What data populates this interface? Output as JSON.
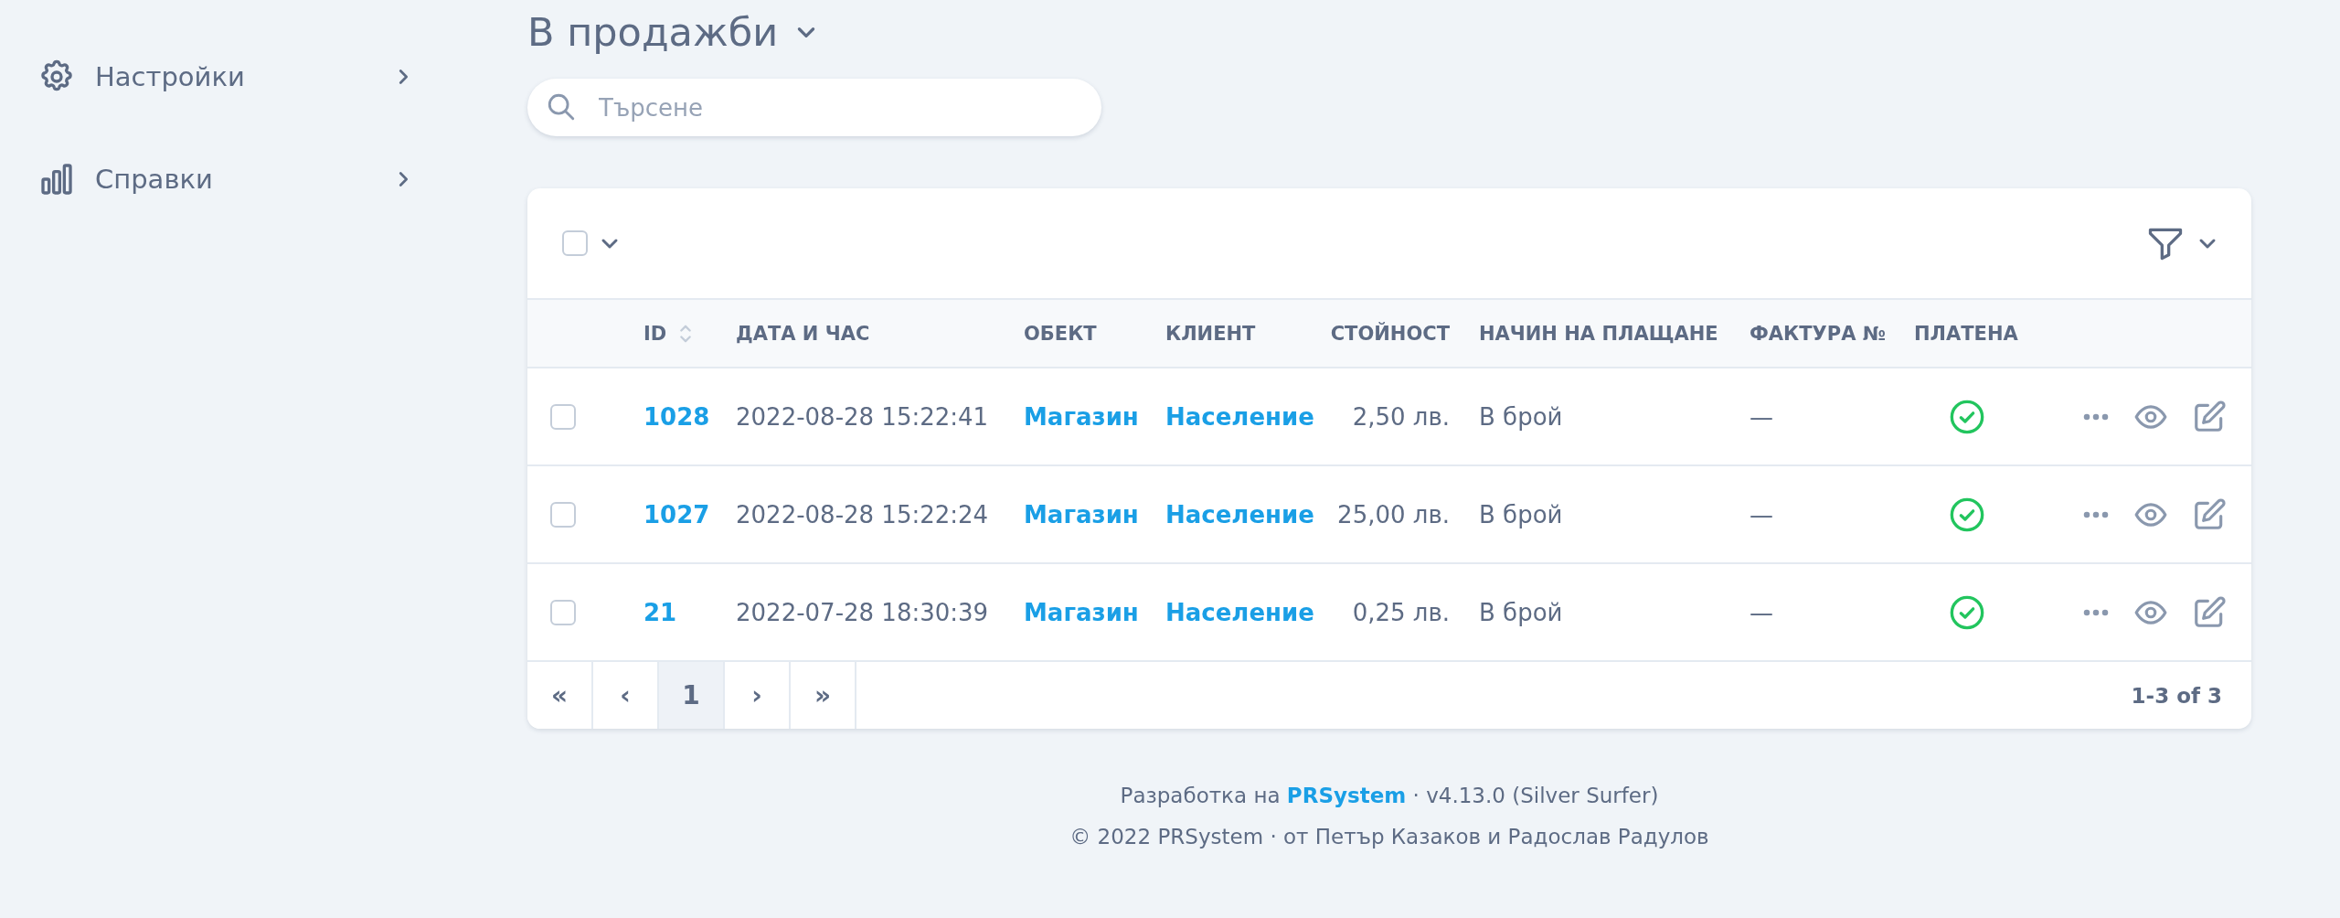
{
  "sidebar": {
    "items": [
      {
        "label": "Настройки"
      },
      {
        "label": "Справки"
      }
    ]
  },
  "page": {
    "title": "В продажби"
  },
  "search": {
    "placeholder": "Търсене"
  },
  "table": {
    "select_all": {
      "checked": false
    },
    "columns": [
      {
        "label": "ID"
      },
      {
        "label": "ДАТА И ЧАС"
      },
      {
        "label": "ОБЕКТ"
      },
      {
        "label": "КЛИЕНТ"
      },
      {
        "label": "СТОЙНОСТ"
      },
      {
        "label": "НАЧИН НА ПЛАЩАНЕ"
      },
      {
        "label": "ФАКТУРА №"
      },
      {
        "label": "ПЛАТЕНА"
      }
    ],
    "rows": [
      {
        "checked": false,
        "id": "1028",
        "datetime": "2022-08-28 15:22:41",
        "object": "Магазин",
        "client": "Население",
        "value": "2,50 лв.",
        "payment": "В брой",
        "invoice": "—",
        "paid": true
      },
      {
        "checked": false,
        "id": "1027",
        "datetime": "2022-08-28 15:22:24",
        "object": "Магазин",
        "client": "Население",
        "value": "25,00 лв.",
        "payment": "В брой",
        "invoice": "—",
        "paid": true
      },
      {
        "checked": false,
        "id": "21",
        "datetime": "2022-07-28 18:30:39",
        "object": "Магазин",
        "client": "Население",
        "value": "0,25 лв.",
        "payment": "В брой",
        "invoice": "—",
        "paid": true
      }
    ],
    "pagination": {
      "pages": [
        {
          "label": "«",
          "selected": false
        },
        {
          "label": "‹",
          "selected": false
        },
        {
          "label": "1",
          "selected": true
        },
        {
          "label": "›",
          "selected": false
        },
        {
          "label": "»",
          "selected": false
        }
      ],
      "summary": "1-3 of 3"
    }
  },
  "footer": {
    "credit": {
      "before": "Разработка на",
      "link": "PRSystem",
      "after": "· v4.13.0 (Silver Surfer)"
    },
    "copyright": "© 2022 PRSystem · от Петър Казаков и Радослав Радулов"
  }
}
